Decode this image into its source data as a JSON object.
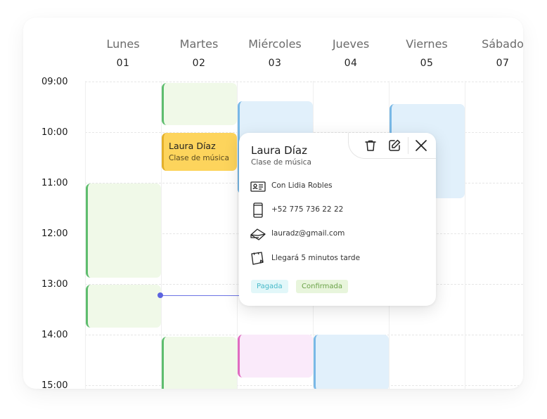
{
  "calendar": {
    "days": [
      {
        "name": "Lunes",
        "num": "01"
      },
      {
        "name": "Martes",
        "num": "02"
      },
      {
        "name": "Miércoles",
        "num": "03"
      },
      {
        "name": "Jueves",
        "num": "04"
      },
      {
        "name": "Viernes",
        "num": "05"
      },
      {
        "name": "Sábado",
        "num": "07"
      }
    ],
    "hours": [
      "09:00",
      "10:00",
      "11:00",
      "12:00",
      "13:00",
      "14:00",
      "15:00"
    ],
    "yellow_event": {
      "title": "Laura Díaz",
      "subtitle": "Clase de música"
    }
  },
  "popup": {
    "name": "Laura Díaz",
    "class": "Clase de música",
    "teacher": "Con Lidia Robles",
    "phone": "+52 775 736 22 22",
    "email": "lauradz@gmail.com",
    "note": "Llegará 5 minutos tarde",
    "badges": {
      "paid": "Pagada",
      "confirmed": "Confirmada"
    },
    "icons": [
      "id-card-icon",
      "phone-icon",
      "envelope-icon",
      "note-icon",
      "trash-icon",
      "edit-icon",
      "close-icon"
    ]
  },
  "colors": {
    "green": "#5ebd6e",
    "blue": "#78b8e6",
    "pink": "#e06cc0",
    "yellow": "#fdd45c",
    "now_line": "#5c63e0"
  }
}
